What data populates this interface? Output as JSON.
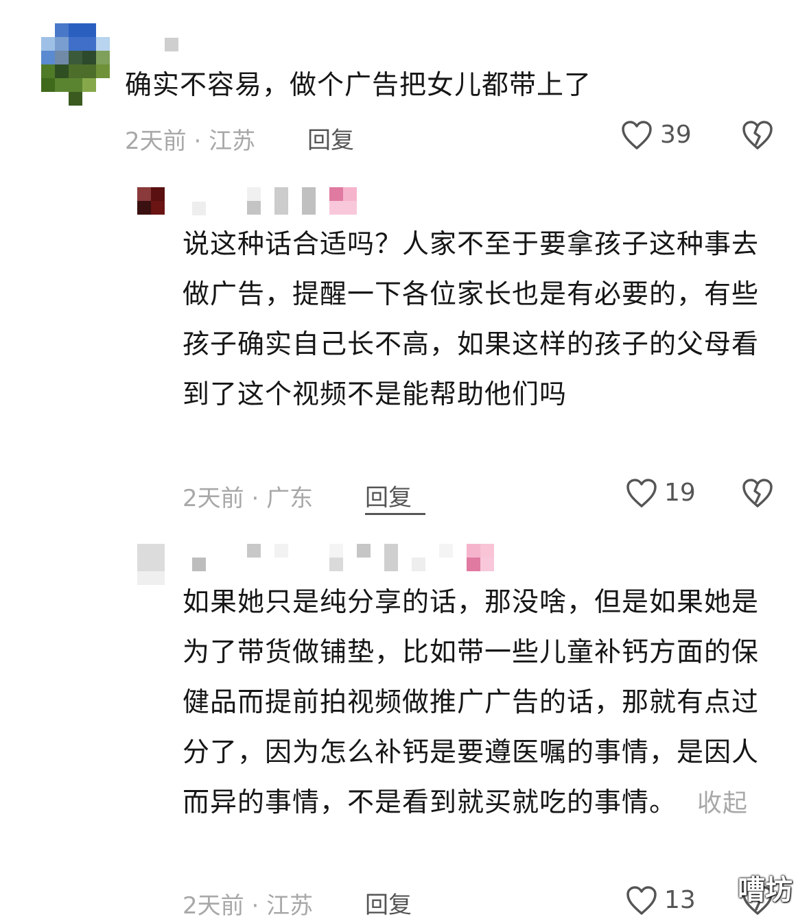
{
  "comments": [
    {
      "text": "确实不容易，做个广告把女儿都带上了",
      "time": "2天前",
      "location": "江苏",
      "reply_label": "回复",
      "likes": "39"
    },
    {
      "text": "说这种话合适吗？人家不至于要拿孩子这种事去做广告，提醒一下各位家长也是有必要的，有些孩子确实自己长不高，如果这样的孩子的父母看到了这个视频不是能帮助他们吗",
      "time": "2天前",
      "location": "广东",
      "reply_label": "回复",
      "likes": "19"
    },
    {
      "text": "如果她只是纯分享的话，那没啥，但是如果她是为了带货做铺垫，比如带一些儿童补钙方面的保健品而提前拍视频做推广广告的话，那就有点过分了，因为怎么补钙是要遵医嘱的事情，是因人而异的事情，不是看到就买就吃的事情。",
      "collapse_label": "收起",
      "time": "2天前",
      "location": "江苏",
      "reply_label": "回复",
      "likes": "13"
    }
  ],
  "separator": "·",
  "icons": {
    "like": "heart-outline-icon",
    "dislike": "broken-heart-icon"
  },
  "colors": {
    "text": "#161616",
    "meta": "#a8a8a8",
    "action": "#555555"
  },
  "watermark": "嘈坊"
}
